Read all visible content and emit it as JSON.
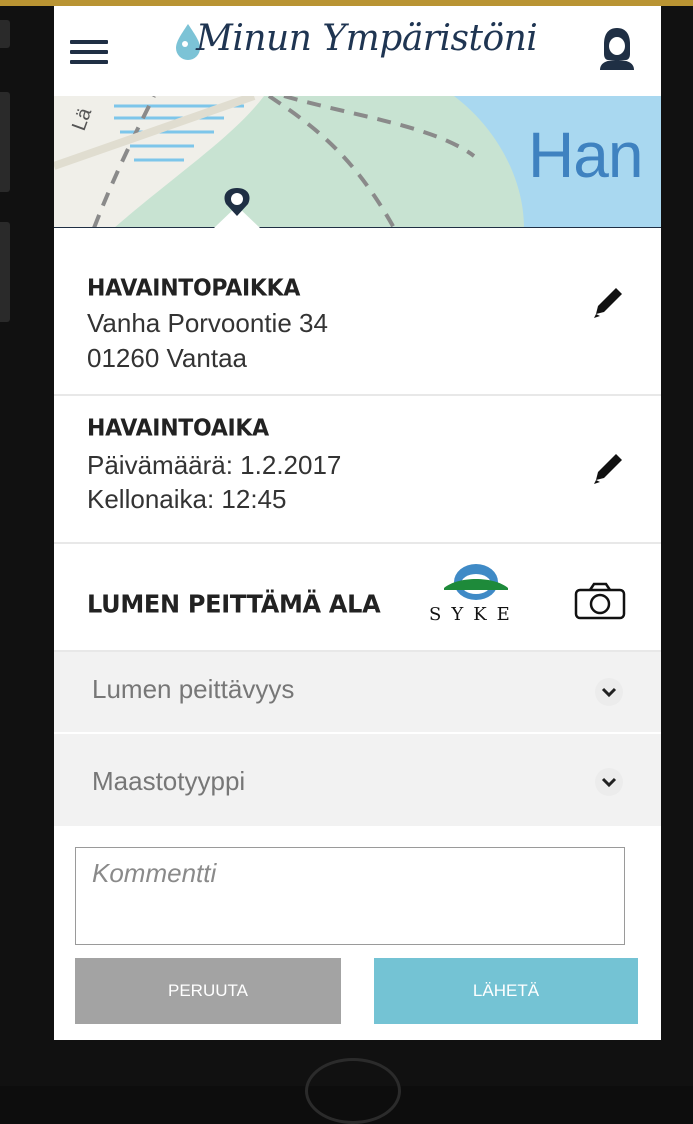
{
  "app": {
    "title": "Minun Ympäristöni"
  },
  "map": {
    "place_label": "Han",
    "street_label": "Lä"
  },
  "location": {
    "heading": "HAVAINTOPAIKKA",
    "line1": "Vanha Porvoontie 34",
    "line2": "01260 Vantaa"
  },
  "time": {
    "heading": "HAVAINTOAIKA",
    "date_line": "Päivämäärä: 1.2.2017",
    "time_line": "Kellonaika: 12:45"
  },
  "observation": {
    "heading": "LUMEN PEITTÄMÄ ALA",
    "partner_logo": "SYKE"
  },
  "form": {
    "coverage_placeholder": "Lumen peittävyys",
    "terrain_placeholder": "Maastotyyppi",
    "comment_placeholder": "Kommentti",
    "cancel_label": "PERUUTA",
    "send_label": "LÄHETÄ"
  },
  "colors": {
    "header_text": "#1f3552",
    "send_button": "#74c3d4",
    "cancel_button": "#a3a3a3",
    "water": "#a9d8f0",
    "land": "#c8e3d2"
  },
  "icons": {
    "menu": "hamburger-icon",
    "avatar": "user-avatar-icon",
    "edit": "pencil-icon",
    "camera": "camera-icon",
    "chevron": "chevron-down-icon",
    "pin": "map-pin-icon"
  }
}
